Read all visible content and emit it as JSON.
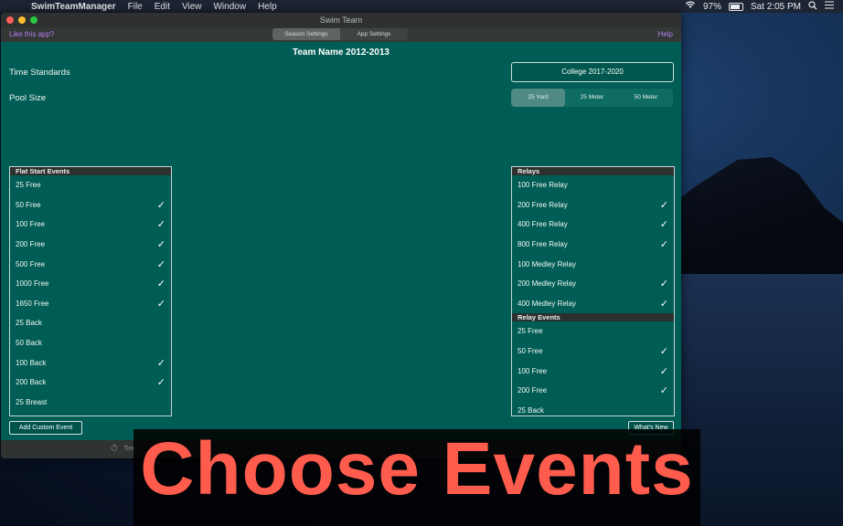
{
  "menubar": {
    "apple": "",
    "app_name": "SwimTeamManager",
    "menus": [
      "File",
      "Edit",
      "View",
      "Window",
      "Help"
    ],
    "battery": "97%",
    "clock": "Sat 2:05 PM"
  },
  "window": {
    "title": "Swim Team",
    "like": "Like this app?",
    "help": "Help",
    "tabs": [
      {
        "label": "Season Settings",
        "active": true
      },
      {
        "label": "App Settings",
        "active": false
      }
    ],
    "team_name": "Team Name 2012-2013",
    "time_standards_label": "Time Standards",
    "time_standards_value": "College 2017-2020",
    "pool_size_label": "Pool Size",
    "pool_sizes": [
      {
        "label": "25 Yard",
        "active": true
      },
      {
        "label": "25 Meter",
        "active": false
      },
      {
        "label": "50 Meter",
        "active": false
      }
    ]
  },
  "flat_start": {
    "header": "Flat Start Events",
    "items": [
      {
        "label": "25 Free",
        "checked": false
      },
      {
        "label": "50 Free",
        "checked": true
      },
      {
        "label": "100 Free",
        "checked": true
      },
      {
        "label": "200 Free",
        "checked": true
      },
      {
        "label": "500 Free",
        "checked": true
      },
      {
        "label": "1000 Free",
        "checked": true
      },
      {
        "label": "1650 Free",
        "checked": true
      },
      {
        "label": "25 Back",
        "checked": false
      },
      {
        "label": "50 Back",
        "checked": false
      },
      {
        "label": "100 Back",
        "checked": true
      },
      {
        "label": "200 Back",
        "checked": true
      },
      {
        "label": "25 Breast",
        "checked": false
      }
    ]
  },
  "relays": {
    "header": "Relays",
    "items": [
      {
        "label": "100 Free Relay",
        "checked": false
      },
      {
        "label": "200 Free Relay",
        "checked": true
      },
      {
        "label": "400 Free Relay",
        "checked": true
      },
      {
        "label": "800 Free Relay",
        "checked": true
      },
      {
        "label": "100 Medley Relay",
        "checked": false
      },
      {
        "label": "200 Medley Relay",
        "checked": true
      },
      {
        "label": "400 Medley Relay",
        "checked": true
      }
    ]
  },
  "relay_events": {
    "header": "Relay Events",
    "items": [
      {
        "label": "25 Free",
        "checked": false
      },
      {
        "label": "50 Free",
        "checked": true
      },
      {
        "label": "100 Free",
        "checked": true
      },
      {
        "label": "200 Free",
        "checked": true
      },
      {
        "label": "25 Back",
        "checked": false
      }
    ]
  },
  "buttons": {
    "add_custom": "Add Custom Event",
    "whats_new": "What's New"
  },
  "footer": {
    "timer_text": "Tim"
  },
  "overlay_text": "Choose Events",
  "checkmark": "✓",
  "colors": {
    "window_bg": "#005d55",
    "link": "#b57bf0",
    "overlay_text": "#ff5c4d"
  }
}
